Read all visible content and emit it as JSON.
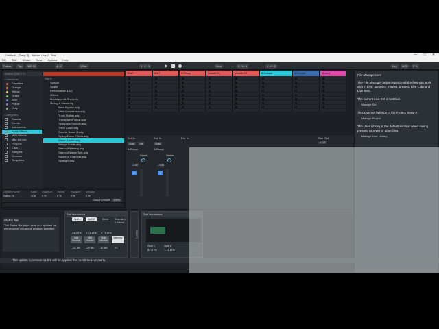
{
  "window": {
    "title": "Untitled* - [Temp-2] - Ableton Live 11 Trial",
    "controls": [
      "—",
      "□",
      "✕"
    ]
  },
  "menu": [
    "File",
    "Edit",
    "Create",
    "View",
    "Options",
    "Help"
  ],
  "transport": {
    "follow": "Follow",
    "tap": "Tap",
    "tempo": "120.00",
    "signature": "4 / 4",
    "quantize": "1 Bar",
    "position": "1 . 1 . 1",
    "loop_start": "3 . 1 . 1",
    "loop_len": "4 . 0 . 0",
    "new": "New",
    "key": "Key",
    "midi": "MIDI",
    "cpu": "2 %"
  },
  "browser": {
    "search_placeholder": "Search (Ctrl + F)",
    "collections_title": "Collections",
    "collections": [
      {
        "label": "Favorites",
        "color": "#e05a5a"
      },
      {
        "label": "Orange",
        "color": "#e88a3a"
      },
      {
        "label": "Yellow",
        "color": "#e4d04a"
      },
      {
        "label": "Green",
        "color": "#6ac04a"
      },
      {
        "label": "Blue",
        "color": "#4a8ae0"
      },
      {
        "label": "Purple",
        "color": "#a46ae0"
      },
      {
        "label": "Gray",
        "color": "#9aa0a6"
      }
    ],
    "categories_title": "Categories",
    "categories": [
      "Sounds",
      "Drums",
      "Instruments",
      "Audio Effects",
      "MIDI Effects",
      "Max for Live",
      "Plug-ins",
      "Clips",
      "Samples",
      "Grooves",
      "Templates"
    ],
    "selected_category": "Audio Effects",
    "name_header": "Name",
    "files": [
      "Special",
      "Space",
      "Performance & DJ",
      "Others",
      "Modulation & Rhythmic",
      "Mixing & Mastering",
      "Bass Bypass.adg",
      "Ultra Compressor.adg",
      "Trunk Rattler.adg",
      "Transparent Vocal.adg",
      "Toolspace Smooth.adg",
      "Think Chain.adg",
      "Sample Boom Z.adg",
      "Spikey Drum Effects.adg",
      "Sheer Exciter.adg",
      "Strings Subtle.adg",
      "Stereo Widening.adg",
      "Stereo Widener Mid.adg",
      "Squeeze Chamber.adg",
      "Spotlight.adg"
    ],
    "highlight_index": 14
  },
  "groove": {
    "headers": [
      "Groove Name",
      "Base",
      "Quantize",
      "Timing",
      "Random",
      "Velocity"
    ],
    "row": [
      "Swing 16",
      "1/16",
      "0 %",
      "0 %",
      "0 %",
      "0 %"
    ],
    "global_label": "Global Amount",
    "global_value": "100%"
  },
  "tracks": [
    {
      "name": "Em7",
      "color": "#e05a5a"
    },
    {
      "name": "Em7",
      "color": "#e05a5a"
    },
    {
      "name": "4 Group",
      "color": "#e05a5a"
    },
    {
      "name": "Vocals C1",
      "color": "#e05a5a"
    },
    {
      "name": "Vocals C2",
      "color": "#e05a5a"
    },
    {
      "name": "6 Guitars",
      "color": "#2ac8d8"
    },
    {
      "name": "A Reverb",
      "color": "#3a6ab0"
    },
    {
      "name": "Master",
      "color": "#e04aa8"
    }
  ],
  "mixer": {
    "routing_in": "Ext. In",
    "routing_all": "All Ins",
    "monitor": [
      "Auto",
      "Off"
    ],
    "sends_label": "Sends",
    "group": "1-Group",
    "cue_out": "Cue Out",
    "cue_value": "ii 1/2",
    "vol_a": "-3.80",
    "vol_b": "-3.55",
    "track_nums": [
      "2",
      "3"
    ]
  },
  "info": {
    "title": "File Management",
    "p1": "The File Manager helps organize all the files you work with in Live: samples, movies, presets, Live Clips and Live Sets.",
    "p2": "The current Live Set is Untitled.",
    "btn1": "Manage Set",
    "p3": "This Live Set belongs to the Project Temp-2.",
    "btn2": "Manage Project",
    "p4": "The User Library is the default location when saving presets, grooves or other files.",
    "btn3": "Manage User Library"
  },
  "device": {
    "title": "Sub Harmonics",
    "title2": "Sub Harmonics",
    "split1": "Split 1",
    "split2": "Split 2",
    "band_labels": [
      "Low",
      "Mid",
      "High"
    ],
    "band_buttons": [
      "Low Volume",
      "Mid Volume",
      "High Volume",
      "Intensity"
    ],
    "freq1": "54.8 Hz",
    "freq2": "1.71 kHz",
    "freq3": "4.71 kHz",
    "gain_vals": [
      "-22 dB",
      "-23 dB",
      "-17 dB",
      "73"
    ],
    "transient": "Transient",
    "attack": "1 Attack",
    "limiter": "Limiter",
    "drive": "Drive"
  },
  "hint": {
    "title": "Status Bar",
    "text": "The Status Bar helps keep you updated on the progress of various program activities."
  },
  "status": "The update to version 11.0.6 will be applied the next time Live starts."
}
